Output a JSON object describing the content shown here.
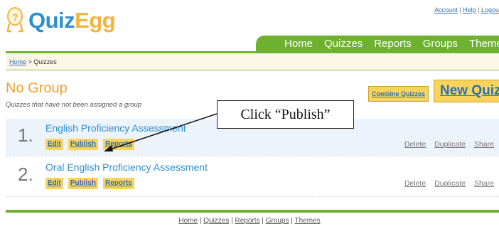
{
  "header": {
    "logo_quiz": "Quiz",
    "logo_egg": "Egg",
    "account_links": [
      "Account",
      "Help",
      "Logou"
    ]
  },
  "nav": {
    "items": [
      "Home",
      "Quizzes",
      "Reports",
      "Groups",
      "Themes"
    ]
  },
  "breadcrumb": {
    "home": "Home",
    "sep": " > ",
    "current": "Quizzes"
  },
  "group": {
    "title": "No Group",
    "description": "Quizzes that have not been assigned a group",
    "combine_label": "Combine Quizzes",
    "new_quiz_label": "New Quiz"
  },
  "callout": {
    "text": "Click “Publish”"
  },
  "quizzes": [
    {
      "number": "1.",
      "name": "English Proficiency Assessment",
      "actions": [
        "Edit",
        "Publish",
        "Reports"
      ],
      "links": [
        "Delete",
        "Duplicate",
        "Share"
      ]
    },
    {
      "number": "2.",
      "name": "Oral English Proficiency Assessment",
      "actions": [
        "Edit",
        "Publish",
        "Reports"
      ],
      "links": [
        "Delete",
        "Duplicate",
        "Share"
      ]
    }
  ],
  "footer": {
    "links": [
      "Home",
      "Quizzes",
      "Reports",
      "Groups",
      "Themes"
    ],
    "sep": " | "
  },
  "colors": {
    "brand_blue": "#2d8fd0",
    "brand_orange": "#f4b43a",
    "nav_green": "#6eb131",
    "button_yellow": "#f8d45c"
  },
  "icons": {
    "logo": "egg-character-icon",
    "callout": "arrow-icon"
  }
}
